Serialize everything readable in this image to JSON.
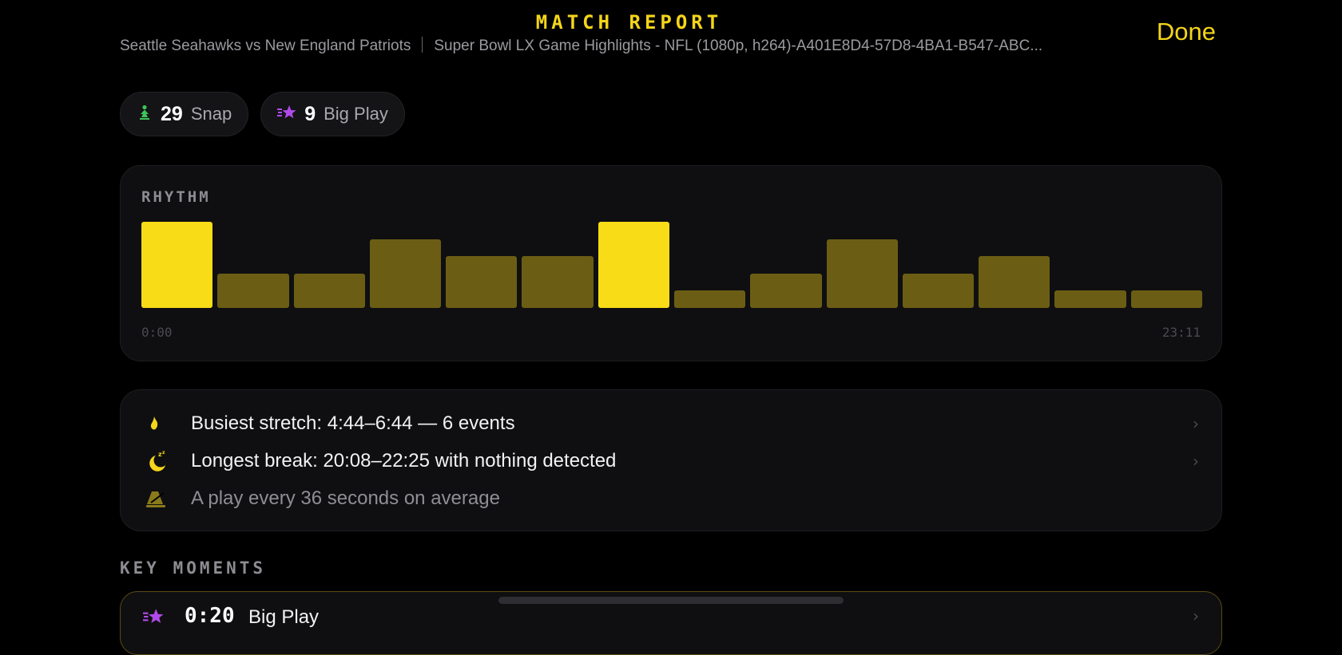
{
  "header": {
    "title": "MATCH REPORT",
    "matchup": "Seattle Seahawks vs New England Patriots",
    "video_name": "Super Bowl LX Game Highlights - NFL (1080p, h264)-A401E8D4-57D8-4BA1-B547-ABC...",
    "done_label": "Done"
  },
  "chips": [
    {
      "icon": "snap-icon",
      "count": "29",
      "label": "Snap",
      "color": "#3ec45a"
    },
    {
      "icon": "big-play-icon",
      "count": "9",
      "label": "Big Play",
      "color": "#b04ae8"
    }
  ],
  "rhythm": {
    "label": "RHYTHM",
    "start_label": "0:00",
    "end_label": "23:11"
  },
  "chart_data": {
    "type": "bar",
    "title": "RHYTHM",
    "x_range": [
      "0:00",
      "23:11"
    ],
    "values": [
      5,
      2,
      2,
      4,
      3,
      3,
      5,
      1,
      2,
      4,
      2,
      3,
      1,
      1
    ],
    "highlighted": [
      true,
      false,
      false,
      false,
      false,
      false,
      true,
      false,
      false,
      false,
      false,
      false,
      false,
      false
    ],
    "highlight_color": "#f7dc17",
    "base_color": "#6b5e14"
  },
  "stats": [
    {
      "icon": "flame-icon",
      "text": "Busiest stretch: 4:44–6:44 — 6 events",
      "has_chevron": true
    },
    {
      "icon": "moon-sleep-icon",
      "text": "Longest break: 20:08–22:25 with nothing detected",
      "has_chevron": true
    },
    {
      "icon": "metronome-icon",
      "text": "A play every 36 seconds on average",
      "has_chevron": false
    }
  ],
  "key_moments": {
    "label": "KEY MOMENTS",
    "items": [
      {
        "icon": "big-play-icon",
        "time": "0:20",
        "kind": "Big Play"
      }
    ]
  },
  "colors": {
    "accent": "#f4d51a",
    "background": "#000000",
    "card": "#0f0f11"
  }
}
